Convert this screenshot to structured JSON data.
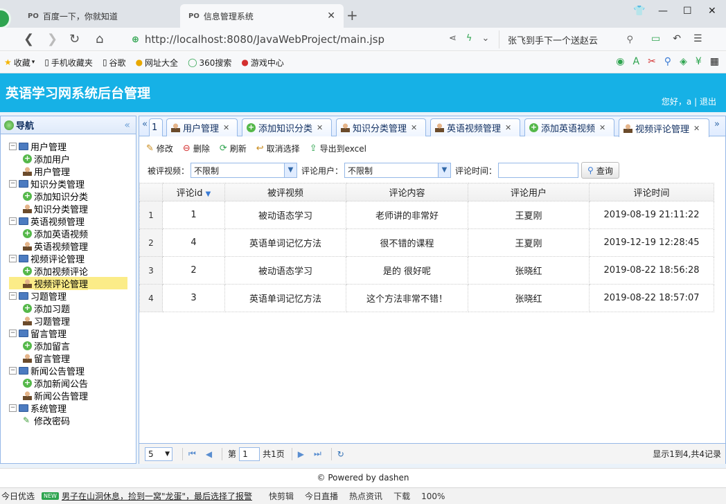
{
  "browser": {
    "tabs": [
      {
        "label": "百度一下，你就知道",
        "active": false
      },
      {
        "label": "信息管理系统",
        "active": true
      }
    ],
    "url": "http://localhost:8080/JavaWebProject/main.jsp",
    "search_text": "张飞到手下一个送赵云",
    "bookmarks": [
      "收藏",
      "手机收藏夹",
      "谷歌",
      "网址大全",
      "360搜索",
      "游戏中心"
    ]
  },
  "app": {
    "title": "英语学习网系统后台管理",
    "greeting": "您好，a",
    "separator": "|",
    "logout": "退出"
  },
  "nav": {
    "title": "导航",
    "groups": [
      {
        "label": "用户管理",
        "items": [
          {
            "label": "添加用户",
            "icon": "add-icon"
          },
          {
            "label": "用户管理",
            "icon": "person-icon"
          }
        ]
      },
      {
        "label": "知识分类管理",
        "items": [
          {
            "label": "添加知识分类",
            "icon": "add-icon"
          },
          {
            "label": "知识分类管理",
            "icon": "person-icon"
          }
        ]
      },
      {
        "label": "英语视频管理",
        "items": [
          {
            "label": "添加英语视频",
            "icon": "add-icon"
          },
          {
            "label": "英语视频管理",
            "icon": "person-icon"
          }
        ]
      },
      {
        "label": "视频评论管理",
        "items": [
          {
            "label": "添加视频评论",
            "icon": "add-icon"
          },
          {
            "label": "视频评论管理",
            "icon": "person-icon",
            "selected": true
          }
        ]
      },
      {
        "label": "习题管理",
        "items": [
          {
            "label": "添加习题",
            "icon": "add-icon"
          },
          {
            "label": "习题管理",
            "icon": "person-icon"
          }
        ]
      },
      {
        "label": "留言管理",
        "items": [
          {
            "label": "添加留言",
            "icon": "add-icon"
          },
          {
            "label": "留言管理",
            "icon": "person-icon"
          }
        ]
      },
      {
        "label": "新闻公告管理",
        "items": [
          {
            "label": "添加新闻公告",
            "icon": "add-icon"
          },
          {
            "label": "新闻公告管理",
            "icon": "person-icon"
          }
        ]
      },
      {
        "label": "系统管理",
        "items": [
          {
            "label": "修改密码",
            "icon": "pencil-icon"
          }
        ]
      }
    ]
  },
  "content_tabs": [
    {
      "label": "1",
      "icon": ""
    },
    {
      "label": "用户管理",
      "icon": "person-icon"
    },
    {
      "label": "添加知识分类",
      "icon": "add-icon"
    },
    {
      "label": "知识分类管理",
      "icon": "person-icon"
    },
    {
      "label": "英语视频管理",
      "icon": "person-icon"
    },
    {
      "label": "添加英语视频",
      "icon": "add-icon"
    },
    {
      "label": "视频评论管理",
      "icon": "person-icon",
      "active": true
    }
  ],
  "toolbar": {
    "edit": "修改",
    "delete": "删除",
    "refresh": "刷新",
    "cancel_select": "取消选择",
    "export": "导出到excel"
  },
  "filters": {
    "video_label": "被评视频：",
    "video_value": "不限制",
    "user_label": "评论用户：",
    "user_value": "不限制",
    "time_label": "评论时间：",
    "time_value": "",
    "query": "查询"
  },
  "grid": {
    "columns": [
      "评论id",
      "被评视频",
      "评论内容",
      "评论用户",
      "评论时间"
    ],
    "rows": [
      {
        "rownum": "1",
        "id": "1",
        "video": "被动语态学习",
        "content": "老师讲的非常好",
        "user": "王夏刚",
        "time": "2019-08-19 21:11:22"
      },
      {
        "rownum": "2",
        "id": "4",
        "video": "英语单词记忆方法",
        "content": "很不错的课程",
        "user": "王夏刚",
        "time": "2019-12-19 12:28:45"
      },
      {
        "rownum": "3",
        "id": "2",
        "video": "被动语态学习",
        "content": "是的 很好呢",
        "user": "张晓红",
        "time": "2019-08-22 18:56:28"
      },
      {
        "rownum": "4",
        "id": "3",
        "video": "英语单词记忆方法",
        "content": "这个方法非常不错！",
        "user": "张晓红",
        "time": "2019-08-22 18:57:07"
      }
    ]
  },
  "pager": {
    "page_size": "5",
    "page_prefix": "第",
    "page_value": "1",
    "page_total": "共1页",
    "info": "显示1到4,共4记录"
  },
  "footer": "© Powered by dashen",
  "statusbar": {
    "left": "今日优选",
    "badge": "NEW",
    "headline": "男子在山洞休息，捡到一窝\"龙蛋\"，最后选择了报警",
    "items": [
      "快剪辑",
      "今日直播",
      "热点资讯",
      "下载",
      "100%"
    ]
  }
}
